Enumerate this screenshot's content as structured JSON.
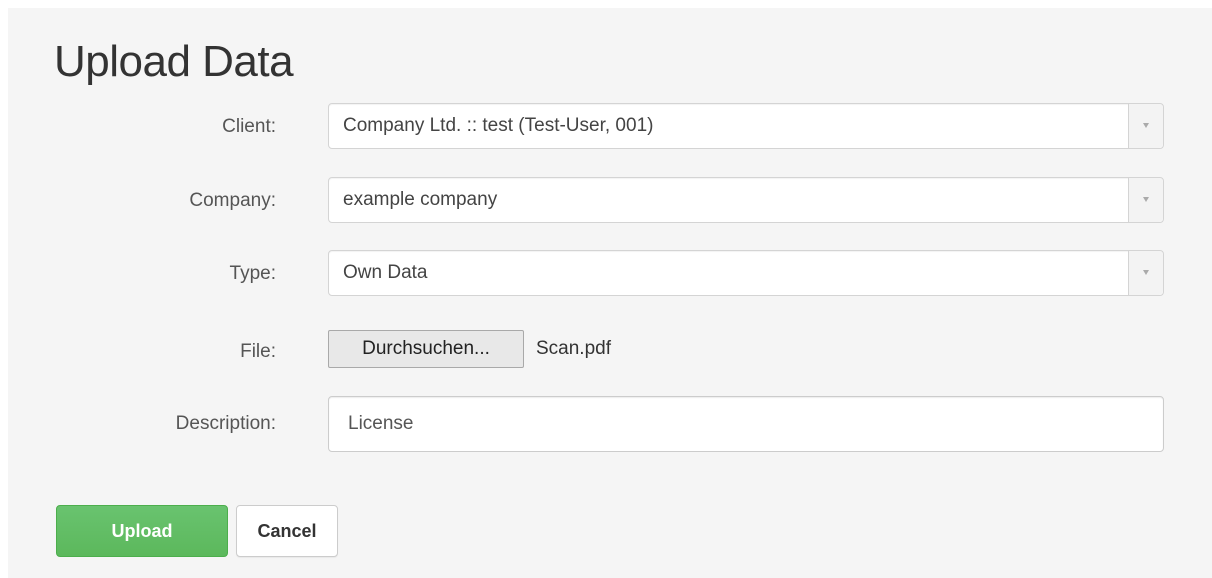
{
  "page": {
    "title": "Upload Data"
  },
  "form": {
    "client": {
      "label": "Client:",
      "value": "Company Ltd. :: test (Test-User, 001)",
      "icon": "chevron-down-icon"
    },
    "company": {
      "label": "Company:",
      "value": "example company",
      "icon": "chevron-down-icon"
    },
    "type": {
      "label": "Type:",
      "value": "Own Data",
      "icon": "chevron-down-icon"
    },
    "file": {
      "label": "File:",
      "button_label": "Durchsuchen...",
      "file_name": "Scan.pdf"
    },
    "description": {
      "label": "Description:",
      "value": "License"
    }
  },
  "actions": {
    "upload_label": "Upload",
    "cancel_label": "Cancel"
  },
  "colors": {
    "primary": "#5cb85c",
    "panel_background": "#f5f5f5"
  }
}
